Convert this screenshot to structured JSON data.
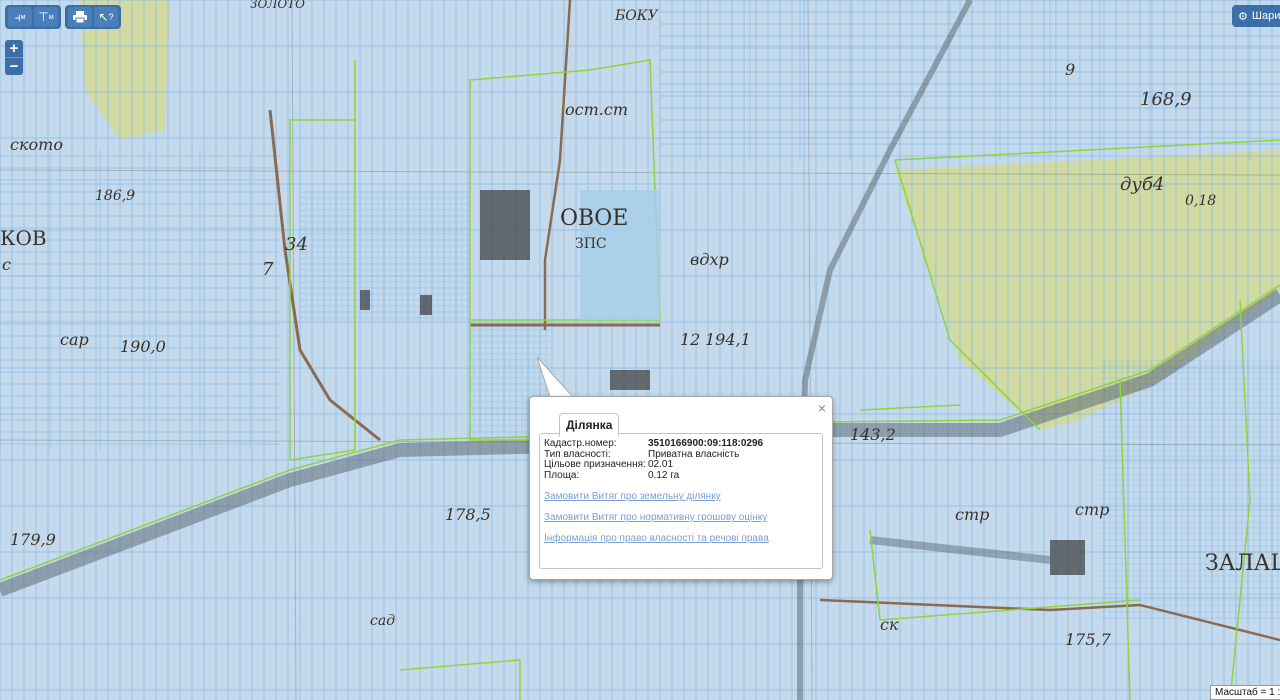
{
  "toolbar": {
    "buttons": [
      {
        "name": "measure-length-button",
        "glyph": "⫞",
        "sub": "м"
      },
      {
        "name": "measure-area-button",
        "glyph": "⊤",
        "sub": "м"
      },
      {
        "name": "print-button",
        "glyph": "🖶",
        "sub": ""
      },
      {
        "name": "info-cursor-button",
        "glyph": "↖",
        "sub": "?"
      }
    ]
  },
  "zoom": {
    "in": "+",
    "out": "−"
  },
  "layers": {
    "label": "Шари"
  },
  "map_labels": {
    "l1": "ЗОЛОТО",
    "l2": "ското",
    "l3": "186,9",
    "l4": "КОВ",
    "l5": "с",
    "l6": "34",
    "l7": "7",
    "l8": "сар",
    "l9": "190,0",
    "l10": "179,9",
    "l11": "178,5",
    "l12": "ОВОЕ",
    "l13": "ЗПС",
    "l14": "вдхр",
    "l15": "ост.ст",
    "l16": "12",
    "l17": "194,1",
    "l18": "168,9",
    "l19": "дуб4",
    "l20": "0,18",
    "l21": "ЗАЛАЦ",
    "l22": "143,2",
    "l23": "стр",
    "l24": "175,7",
    "l25": "БОКУ",
    "l26": "9",
    "l27": "стр",
    "l28": "ск",
    "l29": "сад"
  },
  "popup": {
    "tab": "Ділянка",
    "fields": [
      {
        "key": "Кадастр.номер:",
        "value": "3510166900:09:118:0296",
        "strong": true
      },
      {
        "key": "Тип власності:",
        "value": "Приватна власність",
        "strong": false
      },
      {
        "key": "Цільове призначення:",
        "value": "02.01",
        "strong": false
      },
      {
        "key": "Площа:",
        "value": "0.12 га",
        "strong": false
      }
    ],
    "links": [
      "Замовити Витяг про земельну ділянку",
      "Замовити Витяг про нормативну грошову оцінку",
      "Інформація про право власності та речові права"
    ],
    "close": "×"
  },
  "scale": {
    "label": "Масштаб = 1 :"
  },
  "colors": {
    "parcel": "#7fb2e0",
    "boundary": "#8fd43a",
    "road": "#8a6a50",
    "forest": "#d2d99a",
    "toolbar": "#3c6fa8"
  }
}
